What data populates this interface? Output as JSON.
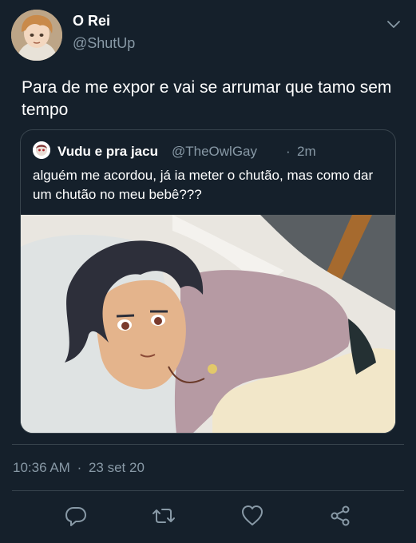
{
  "tweet": {
    "author": {
      "display_name": "O Rei",
      "handle": "@ShutUp",
      "avatar_icon": "avatar"
    },
    "text": "Para de me expor e vai se arrumar que tamo sem tempo",
    "quoted": {
      "display_name": "Vudu e pra jacu",
      "handle": "@TheOwlGay",
      "separator": "·",
      "time": "2m",
      "text": "alguém me acordou, já ia meter o chutão, mas como dar um chutão no meu bebê???",
      "media": "image"
    },
    "time": "10:36 AM",
    "separator": "·",
    "date": "23 set 20"
  },
  "actions": [
    {
      "icon": "reply-icon"
    },
    {
      "icon": "retweet-icon"
    },
    {
      "icon": "like-icon"
    },
    {
      "icon": "share-icon"
    }
  ],
  "colors": {
    "background": "#15202b",
    "text": "#ffffff",
    "secondary_text": "#8899a6",
    "border": "#38444d"
  }
}
